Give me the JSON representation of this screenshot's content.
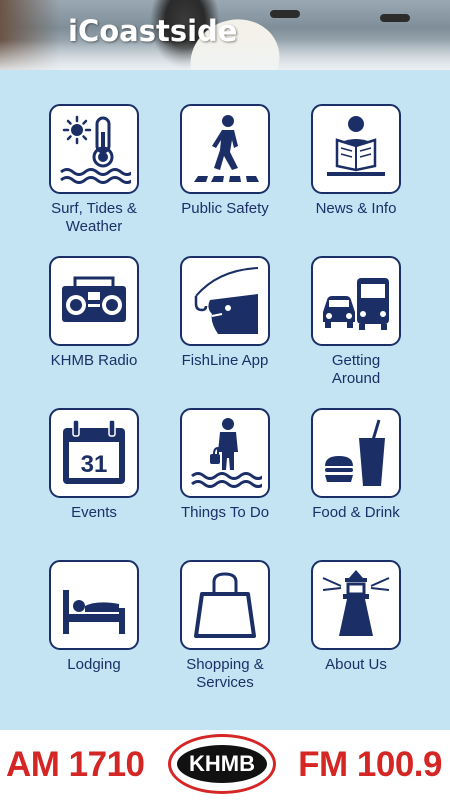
{
  "app": {
    "title": "iCoastside"
  },
  "colors": {
    "tile_border": "#1b2f66",
    "background": "#c4e4f4",
    "radio_red": "#d52626"
  },
  "tiles": [
    {
      "label": "Surf, Tides &\nWeather",
      "icon": "thermometer-sun-waves-icon"
    },
    {
      "label": "Public Safety",
      "icon": "pedestrian-crosswalk-icon"
    },
    {
      "label": "News & Info",
      "icon": "person-reading-icon"
    },
    {
      "label": "KHMB Radio",
      "icon": "boombox-radio-icon"
    },
    {
      "label": "FishLine App",
      "icon": "fish-hook-icon"
    },
    {
      "label": "Getting\nAround",
      "icon": "car-bus-icon"
    },
    {
      "label": "Events",
      "icon": "calendar-icon"
    },
    {
      "label": "Things To Do",
      "icon": "beach-person-icon"
    },
    {
      "label": "Food & Drink",
      "icon": "burger-drink-icon"
    },
    {
      "label": "Lodging",
      "icon": "bed-icon"
    },
    {
      "label": "Shopping &\nServices",
      "icon": "shopping-bag-icon"
    },
    {
      "label": "About Us",
      "icon": "lighthouse-icon"
    }
  ],
  "calendar": {
    "day": "31"
  },
  "footer": {
    "am": "AM 1710",
    "logo": "KHMB",
    "fm": "FM 100.9"
  }
}
